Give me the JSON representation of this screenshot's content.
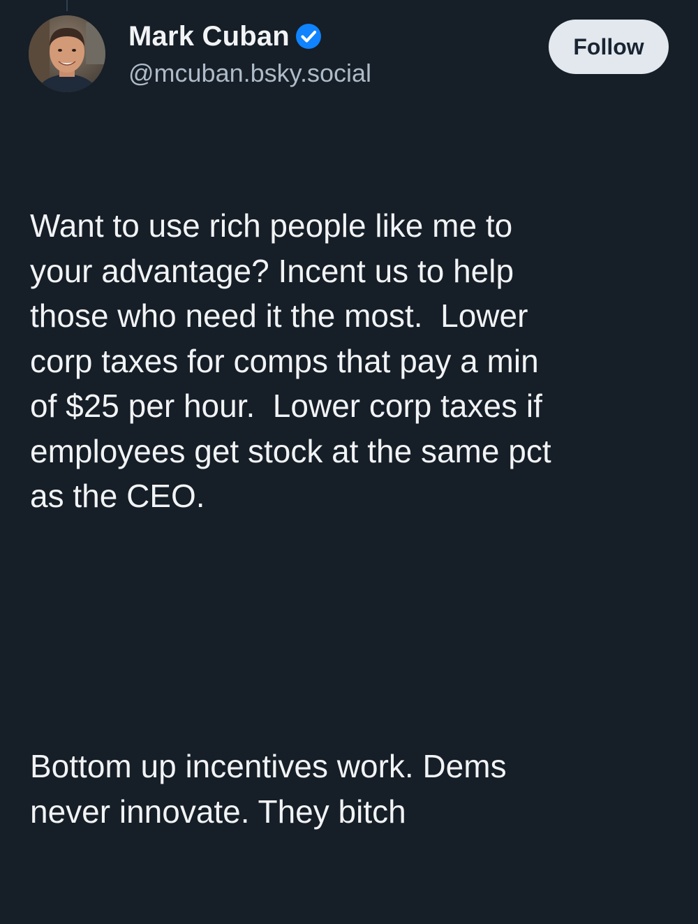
{
  "post": {
    "author": {
      "display_name": "Mark Cuban",
      "handle": "@mcuban.bsky.social",
      "verified": true,
      "verified_icon": "verified-check-icon",
      "avatar_icon": "avatar-photo"
    },
    "follow_label": "Follow",
    "text_paragraphs": [
      "Want to use rich people like me to\nyour advantage? Incent us to help\nthose who need it the most.  Lower\ncorp taxes for comps that pay a min\nof $25 per hour.  Lower corp taxes if\nemployees get stock at the same pct\nas the CEO.",
      "Bottom up incentives work. Dems\nnever innovate. They bitch"
    ]
  },
  "colors": {
    "background": "#161e27",
    "text": "#f1f3f5",
    "handle": "#aebbc9",
    "verified": "#1083fe",
    "follow_bg": "#e3e8ee",
    "follow_text": "#1a2533"
  }
}
